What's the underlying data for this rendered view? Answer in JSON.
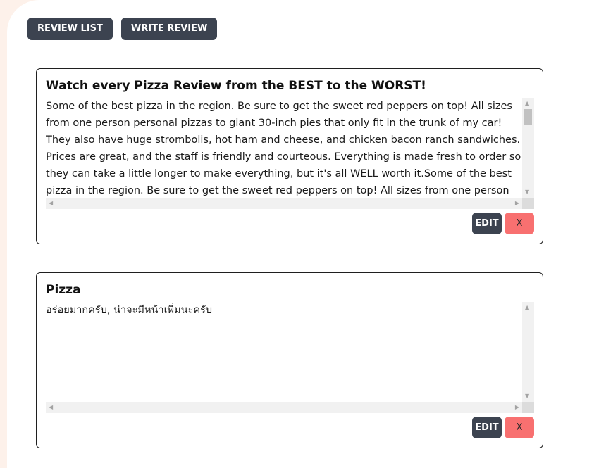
{
  "nav": {
    "review_list_label": "REVIEW LIST",
    "write_review_label": "WRITE REVIEW"
  },
  "reviews": [
    {
      "title": "Watch every Pizza Review from the BEST to the WORST!",
      "text": "Some of the best pizza in the region. Be sure to get the sweet red peppers on top! All sizes from one person personal pizzas to giant 30-inch pies that only fit in the trunk of my car! They also have huge strombolis, hot ham and cheese, and chicken bacon ranch sandwiches. Prices are great, and the staff is friendly and courteous. Everything is made fresh to order so they can take a little longer to make everything, but it's all WELL worth it.Some of the best pizza in the region. Be sure to get the sweet red peppers on top! All sizes from one person personal pizzas",
      "edit_label": "EDIT",
      "delete_label": "X"
    },
    {
      "title": "Pizza",
      "text": "อร่อยมากครับ, น่าจะมีหน้าเพิ่มนะครับ",
      "edit_label": "EDIT",
      "delete_label": "X"
    }
  ],
  "icons": {
    "scroll_up": "▲",
    "scroll_down": "▼",
    "scroll_left": "◀",
    "scroll_right": "▶"
  },
  "colors": {
    "button_dark": "#3c4350",
    "delete_button": "#f87070",
    "background_accent": "#fdf1ea"
  }
}
